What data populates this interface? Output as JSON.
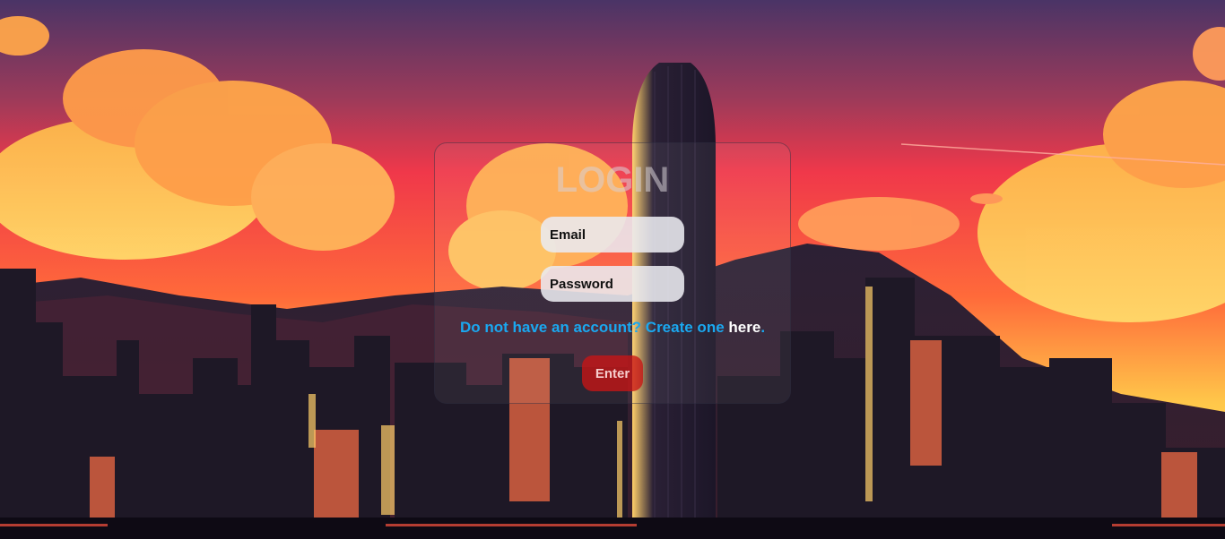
{
  "login": {
    "title": "LOGIN",
    "email_placeholder": "Email",
    "password_placeholder": "Password",
    "signup_prompt": "Do not have an account? Create one ",
    "signup_link": "here",
    "signup_period": ".",
    "enter_label": "Enter"
  },
  "colors": {
    "sky_top": "#4a3466",
    "sky_mid": "#f0384a",
    "sky_low": "#ffd35a",
    "link_blue": "#1aa8f0",
    "button_red": "#c81414"
  }
}
